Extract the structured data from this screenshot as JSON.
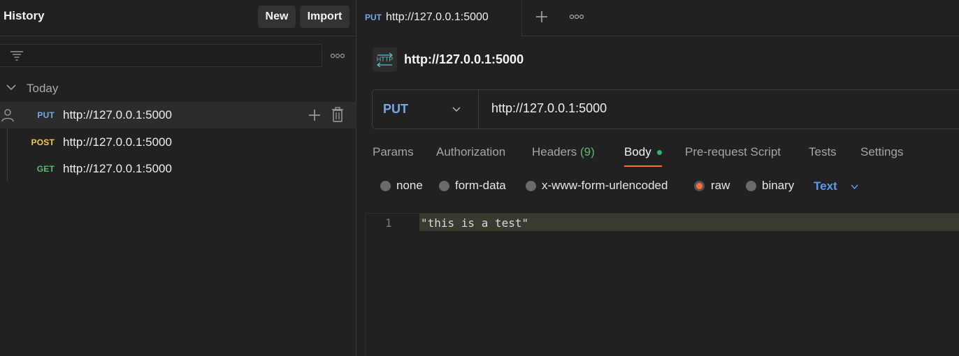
{
  "sidebar": {
    "title": "History",
    "new_label": "New",
    "import_label": "Import",
    "group_label": "Today",
    "items": [
      {
        "method": "PUT",
        "method_color": "#78a7e6",
        "url": "http://127.0.0.1:5000",
        "active": true
      },
      {
        "method": "POST",
        "method_color": "#f0c85a",
        "url": "http://127.0.0.1:5000",
        "active": false
      },
      {
        "method": "GET",
        "method_color": "#5bb974",
        "url": "http://127.0.0.1:5000",
        "active": false
      }
    ]
  },
  "tabs": [
    {
      "method": "PUT",
      "url": "http://127.0.0.1:5000"
    }
  ],
  "request": {
    "name": "http://127.0.0.1:5000",
    "method": "PUT",
    "url": "http://127.0.0.1:5000",
    "tabs": {
      "params": "Params",
      "authorization": "Authorization",
      "headers": "Headers",
      "headers_count": "(9)",
      "body": "Body",
      "prerequest": "Pre-request Script",
      "tests": "Tests",
      "settings": "Settings"
    },
    "body_types": {
      "none": "none",
      "form_data": "form-data",
      "urlencoded": "x-www-form-urlencoded",
      "raw": "raw",
      "binary": "binary",
      "selected": "raw"
    },
    "format": "Text",
    "editor": {
      "line_number": "1",
      "content": "\"this is a test\""
    }
  },
  "colors": {
    "accent": "#ff6c37",
    "put": "#78a7e6",
    "post": "#f0c85a",
    "get": "#5bb974",
    "link": "#5b9bef"
  }
}
